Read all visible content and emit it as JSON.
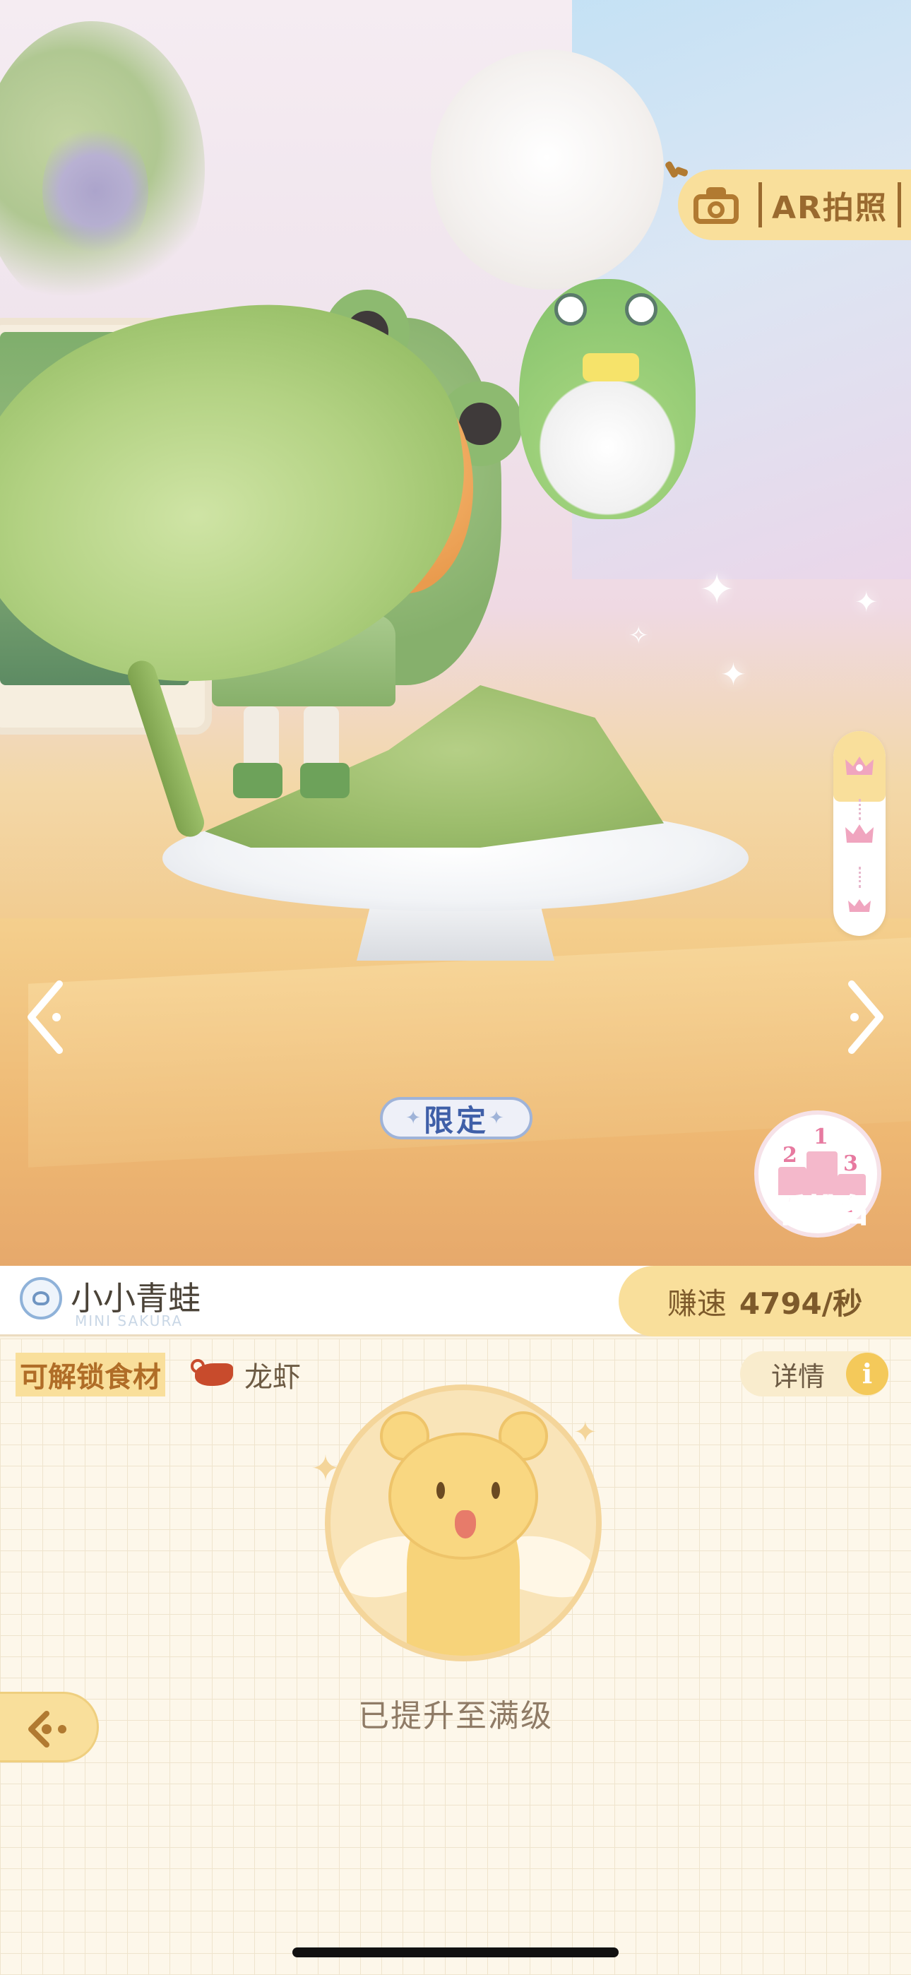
{
  "scene": {
    "ar_button": {
      "label": "AR拍照",
      "icon": "camera-icon"
    },
    "crown_rail": {
      "icons": [
        "crown-icon",
        "crown-icon",
        "crown-icon"
      ],
      "active_index": 0
    },
    "nav": {
      "prev_icon": "chevron-left-icon",
      "next_icon": "chevron-right-icon"
    },
    "limited_badge": "限定",
    "ranking": {
      "label": "看排名",
      "podium": [
        "2",
        "1",
        "3"
      ]
    }
  },
  "info_bar": {
    "name": "小小青蛙",
    "name_subtitle": "MINI SAKURA",
    "speed_label": "赚速",
    "speed_value": "4794/秒"
  },
  "panel": {
    "unlock_label": "可解锁食材",
    "ingredient": {
      "name": "龙虾",
      "icon": "lobster-icon"
    },
    "detail_label": "详情",
    "detail_icon": "info-icon",
    "status": "已提升至满级",
    "back_icon": "back-arrow-icon"
  },
  "colors": {
    "accent_yellow": "#f9df9b",
    "accent_brown": "#9a6a2f",
    "pink": "#ef6f9b",
    "badge_blue": "#3f5fa8"
  }
}
